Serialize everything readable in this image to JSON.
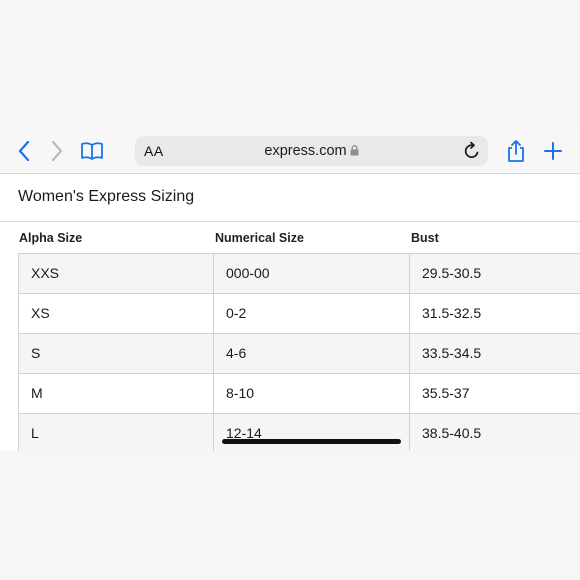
{
  "browser": {
    "text_size_label": "AA",
    "domain": "express.com",
    "accent_color": "#1a73e8",
    "icons": [
      "back-chevron-icon",
      "forward-chevron-icon",
      "bookmarks-book-icon",
      "lock-icon",
      "reload-icon",
      "share-icon",
      "new-tab-plus-icon"
    ]
  },
  "page": {
    "title": "Women's Express Sizing",
    "table": {
      "headers": [
        "Alpha Size",
        "Numerical Size",
        "Bust"
      ],
      "rows": [
        [
          "XXS",
          "000-00",
          "29.5-30.5"
        ],
        [
          "XS",
          "0-2",
          "31.5-32.5"
        ],
        [
          "S",
          "4-6",
          "33.5-34.5"
        ],
        [
          "M",
          "8-10",
          "35.5-37"
        ],
        [
          "L",
          "12-14",
          "38.5-40.5"
        ]
      ]
    }
  }
}
